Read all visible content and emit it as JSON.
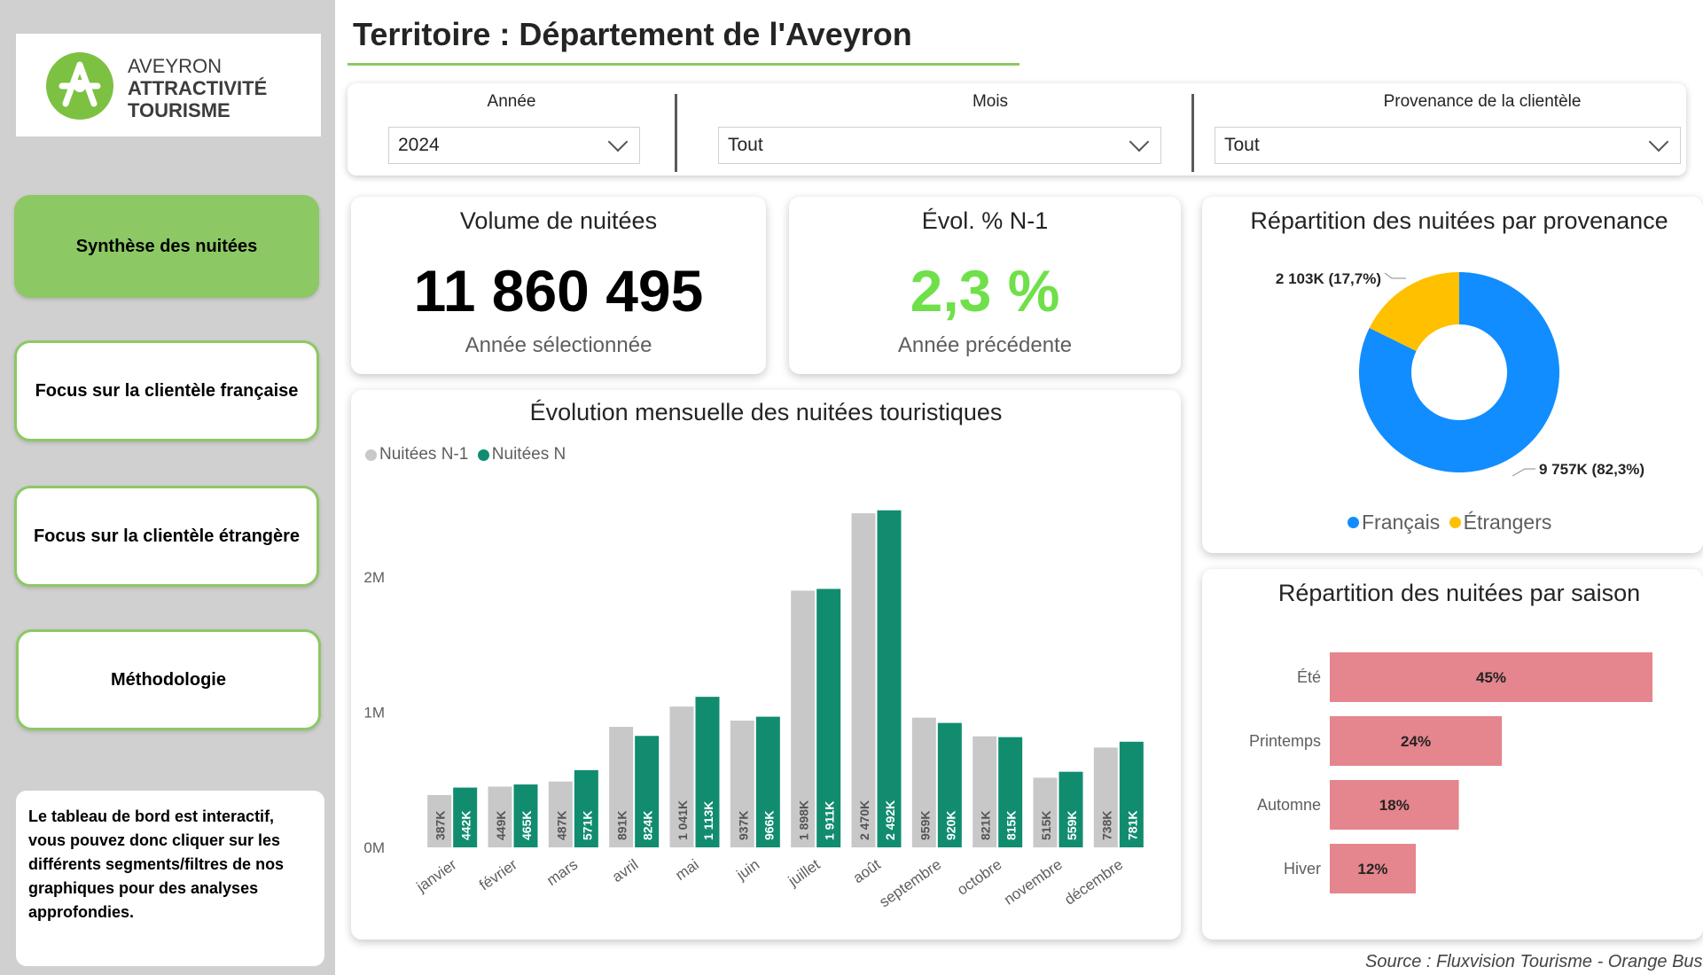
{
  "brand": {
    "line1": "AVEYRON",
    "line2": "ATTRACTIVITÉ",
    "line3": "TOURISME",
    "color": "#7dc142"
  },
  "nav": {
    "items": [
      {
        "label": "Synthèse des nuitées",
        "active": true
      },
      {
        "label": "Focus sur la clientèle française",
        "active": false
      },
      {
        "label": "Focus sur la clientèle étrangère",
        "active": false
      },
      {
        "label": "Méthodologie",
        "active": false
      }
    ]
  },
  "info_text": "Le tableau de bord est interactif, vous pouvez donc cliquer sur les différents segments/filtres de nos graphiques pour des analyses approfondies.",
  "header": {
    "title": "Territoire : Département de l'Aveyron"
  },
  "filters": {
    "annee": {
      "label": "Année",
      "value": "2024"
    },
    "mois": {
      "label": "Mois",
      "value": "Tout"
    },
    "provenance": {
      "label": "Provenance de la clientèle",
      "value": "Tout"
    }
  },
  "kpi_volume": {
    "title": "Volume de nuitées",
    "value": "11 860 495",
    "sub": "Année sélectionnée"
  },
  "kpi_evol": {
    "title": "Évol. % N-1",
    "value": "2,3 %",
    "sub": "Année précédente",
    "color": "#6fe04a"
  },
  "source": "Source : Fluxvision Tourisme - Orange Business",
  "chart_data": [
    {
      "type": "bar",
      "title": "Évolution mensuelle des nuitées touristiques",
      "categories": [
        "janvier",
        "février",
        "mars",
        "avril",
        "mai",
        "juin",
        "juillet",
        "août",
        "septembre",
        "octobre",
        "novembre",
        "décembre"
      ],
      "series": [
        {
          "name": "Nuitées N-1",
          "color": "#c8c8c8",
          "values": [
            387000,
            449000,
            487000,
            891000,
            1041000,
            937000,
            1898000,
            2470000,
            959000,
            821000,
            515000,
            738000
          ],
          "labels": [
            "387K",
            "449K",
            "487K",
            "891K",
            "1 041K",
            "937K",
            "1 898K",
            "2 470K",
            "959K",
            "821K",
            "515K",
            "738K"
          ]
        },
        {
          "name": "Nuitées N",
          "color": "#118c6f",
          "values": [
            442000,
            465000,
            571000,
            824000,
            1113000,
            966000,
            1911000,
            2492000,
            920000,
            815000,
            559000,
            781000
          ],
          "labels": [
            "442K",
            "465K",
            "571K",
            "824K",
            "1 113K",
            "966K",
            "1 911K",
            "2 492K",
            "920K",
            "815K",
            "559K",
            "781K"
          ]
        }
      ],
      "yticks": [
        "0M",
        "1M",
        "2M"
      ],
      "ylim": [
        0,
        2700000
      ],
      "legend": "top-left",
      "grid": false
    },
    {
      "type": "pie",
      "title": "Répartition des nuitées par provenance",
      "slices": [
        {
          "name": "Français",
          "value": 82.3,
          "label": "9 757K (82,3%)",
          "color": "#118dff"
        },
        {
          "name": "Étrangers",
          "value": 17.7,
          "label": "2 103K (17,7%)",
          "color": "#ffc000"
        }
      ],
      "donut": true,
      "legend": "bottom"
    },
    {
      "type": "bar",
      "orientation": "horizontal",
      "title": "Répartition des nuitées par saison",
      "categories": [
        "Été",
        "Printemps",
        "Automne",
        "Hiver"
      ],
      "values": [
        45,
        24,
        18,
        12
      ],
      "labels": [
        "45%",
        "24%",
        "18%",
        "12%"
      ],
      "color": "#e5858d",
      "xlim": [
        0,
        45
      ]
    }
  ]
}
